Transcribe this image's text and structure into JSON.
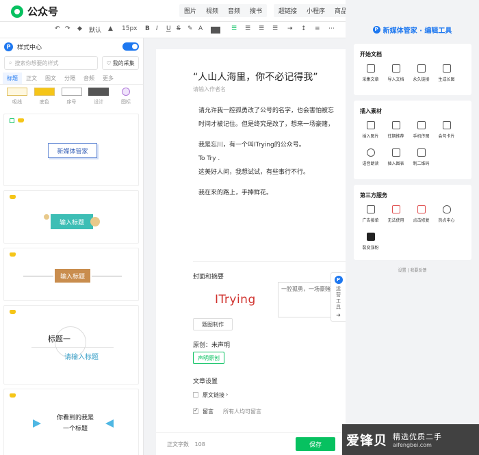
{
  "header": {
    "app_title": "公众号",
    "media_buttons": [
      "图片",
      "视频",
      "音频",
      "搜书"
    ],
    "insert_buttons": [
      "超链接",
      "小程序",
      "商品"
    ]
  },
  "toolbar": {
    "style_label": "默认",
    "font_size": "15px",
    "bold": "B",
    "italic": "I",
    "underline": "U",
    "strike": "S",
    "font_color": "A"
  },
  "sidebar": {
    "title": "样式中心",
    "search_placeholder": "搜索你想要的样式",
    "fav_label": "我的采集",
    "tabs": [
      "标题",
      "正文",
      "图文",
      "分隔",
      "音频",
      "更多"
    ],
    "subcats": [
      "吸线",
      "底色",
      "序号",
      "设计",
      "图标"
    ],
    "cards": [
      {
        "text": "新媒体管家"
      },
      {
        "text": "输入标题"
      },
      {
        "text": "输入标题"
      },
      {
        "line1": "标题一",
        "line2": "请输入标题"
      },
      {
        "line1": "你看到的我是",
        "line2": "一个标题"
      }
    ]
  },
  "article": {
    "title": "“人山人海里，你不必记得我”",
    "author_placeholder": "请输入作者名",
    "paragraphs": [
      "请允许我一腔孤勇改了公号的名字，也会害怕被忘",
      "时间才被记住。但是终究是改了，想来一场豪赌，",
      "",
      "我是忘川，有一个叫ITrying的公众号。",
      "To Try .",
      "这美好人间，我想试试，有些事行不行。",
      "",
      "我在来的路上，手捧鲜花。"
    ],
    "cover_section": "封面和摘要",
    "cover_text": "ITrying",
    "summary_text": "一腔孤勇，一场豪赌",
    "cover_button": "题图制作",
    "original_label": "原创：未声明",
    "declare_button": "声明原创",
    "settings_label": "文章设置",
    "original_link": "原文链接",
    "comment_label": "留言",
    "comment_scope": "所有人均可留言"
  },
  "bottom": {
    "word_count_label": "正文字数",
    "word_count": "108",
    "save_label": "保存"
  },
  "float_tab": {
    "text": "运营工具"
  },
  "right_panel": {
    "title": "新媒体管家 · 编辑工具",
    "sections": [
      {
        "title": "开始文档",
        "items": [
          "采集文章",
          "导入文档",
          "永久链接",
          "生成长图"
        ]
      },
      {
        "title": "插入素材",
        "items": [
          "插入图片",
          "往期推荐",
          "手机传图",
          "会句卡片",
          "语音朗读",
          "插入图表",
          "制二维码"
        ]
      },
      {
        "title": "第三方服务",
        "items": [
          "广告接单",
          "无法使用",
          "点击修复",
          "热点中心",
          "裂变涨粉"
        ]
      }
    ],
    "footer": "设置 | 我要反馈"
  },
  "watermark": {
    "main": "爱锋贝",
    "slogan": "精选优质二手",
    "url": "aifengbei.com"
  },
  "colors": {
    "brand_green": "#07c160",
    "accent_blue": "#1e78f0",
    "cover_red": "#d0312d"
  }
}
